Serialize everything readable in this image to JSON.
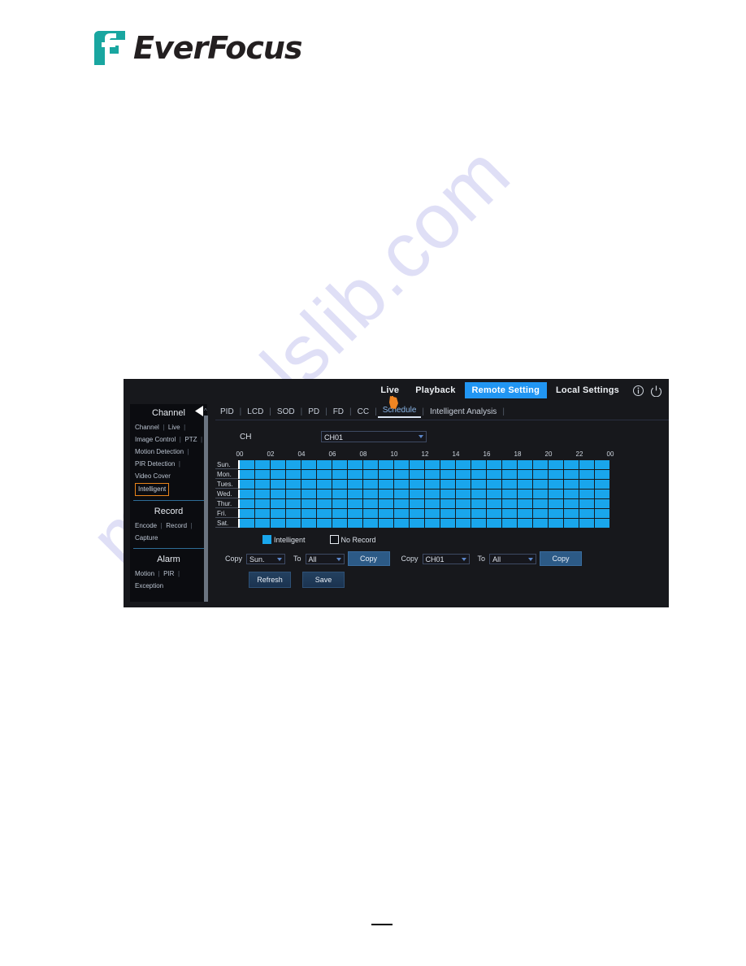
{
  "watermark": {
    "text": "manualslib.com"
  },
  "brand": {
    "name": "EverFocus",
    "mark_color": "#19a6a0",
    "text_color": "#231f20"
  },
  "device_ui": {
    "top_nav": {
      "items": [
        {
          "label": "Live",
          "active": false
        },
        {
          "label": "Playback",
          "active": false
        },
        {
          "label": "Remote Setting",
          "active": true
        },
        {
          "label": "Local Settings",
          "active": false
        }
      ],
      "icons": [
        {
          "name": "info-icon",
          "glyph": "info"
        },
        {
          "name": "power-icon",
          "glyph": "power"
        }
      ],
      "active_color": "#2196f3"
    },
    "sub_tabs": [
      {
        "label": "PID",
        "active": false
      },
      {
        "label": "LCD",
        "active": false
      },
      {
        "label": "SOD",
        "active": false
      },
      {
        "label": "PD",
        "active": false
      },
      {
        "label": "FD",
        "active": false
      },
      {
        "label": "CC",
        "active": false
      },
      {
        "label": "Schedule",
        "active": true
      },
      {
        "label": "Intelligent Analysis",
        "active": false
      }
    ],
    "sidebar": {
      "sections": [
        {
          "title": "Channel",
          "rows": [
            [
              {
                "label": "Channel",
                "highlight": false
              },
              {
                "label": "Live",
                "highlight": false
              }
            ],
            [
              {
                "label": "Image Control",
                "highlight": false
              },
              {
                "label": "PTZ",
                "highlight": false
              }
            ],
            [
              {
                "label": "Motion Detection",
                "highlight": false
              }
            ],
            [
              {
                "label": "PIR Detection",
                "highlight": false
              }
            ],
            [
              {
                "label": "Video Cover",
                "highlight": false,
                "no_sep": true
              }
            ],
            [
              {
                "label": "Intelligent",
                "highlight": true,
                "no_sep": true
              }
            ]
          ]
        },
        {
          "title": "Record",
          "rows": [
            [
              {
                "label": "Encode",
                "highlight": false
              },
              {
                "label": "Record",
                "highlight": false
              }
            ],
            [
              {
                "label": "Capture",
                "highlight": false,
                "no_sep": true
              }
            ]
          ]
        },
        {
          "title": "Alarm",
          "rows": [
            [
              {
                "label": "Motion",
                "highlight": false
              },
              {
                "label": "PIR",
                "highlight": false
              }
            ],
            [
              {
                "label": "Exception",
                "highlight": false,
                "no_sep": true
              }
            ]
          ]
        }
      ],
      "highlight_color": "#e8841a"
    },
    "channel_row": {
      "label": "CH",
      "selected": "CH01"
    },
    "schedule": {
      "time_labels": [
        "00",
        "02",
        "04",
        "06",
        "08",
        "10",
        "12",
        "14",
        "16",
        "18",
        "20",
        "22",
        "00"
      ],
      "days": [
        "Sun.",
        "Mon.",
        "Tues.",
        "Wed.",
        "Thur.",
        "Fri.",
        "Sat."
      ],
      "hours_per_day": 24,
      "cells": [
        [
          1,
          1,
          1,
          1,
          1,
          1,
          1,
          1,
          1,
          1,
          1,
          1,
          1,
          1,
          1,
          1,
          1,
          1,
          1,
          1,
          1,
          1,
          1,
          1
        ],
        [
          1,
          1,
          1,
          1,
          1,
          1,
          1,
          1,
          1,
          1,
          1,
          1,
          1,
          1,
          1,
          1,
          1,
          1,
          1,
          1,
          1,
          1,
          1,
          1
        ],
        [
          1,
          1,
          1,
          1,
          1,
          1,
          1,
          1,
          1,
          1,
          1,
          1,
          1,
          1,
          1,
          1,
          1,
          1,
          1,
          1,
          1,
          1,
          1,
          1
        ],
        [
          1,
          1,
          1,
          1,
          1,
          1,
          1,
          1,
          1,
          1,
          1,
          1,
          1,
          1,
          1,
          1,
          1,
          1,
          1,
          1,
          1,
          1,
          1,
          1
        ],
        [
          1,
          1,
          1,
          1,
          1,
          1,
          1,
          1,
          1,
          1,
          1,
          1,
          1,
          1,
          1,
          1,
          1,
          1,
          1,
          1,
          1,
          1,
          1,
          1
        ],
        [
          1,
          1,
          1,
          1,
          1,
          1,
          1,
          1,
          1,
          1,
          1,
          1,
          1,
          1,
          1,
          1,
          1,
          1,
          1,
          1,
          1,
          1,
          1,
          1
        ],
        [
          1,
          1,
          1,
          1,
          1,
          1,
          1,
          1,
          1,
          1,
          1,
          1,
          1,
          1,
          1,
          1,
          1,
          1,
          1,
          1,
          1,
          1,
          1,
          1
        ]
      ],
      "fill_color": "#19a6ec"
    },
    "legend": [
      {
        "label": "Intelligent",
        "state": "on"
      },
      {
        "label": "No Record",
        "state": "off"
      }
    ],
    "copy_day_row": {
      "copy_label": "Copy",
      "source": "Sun.",
      "to_label": "To",
      "target": "All",
      "button": "Copy"
    },
    "copy_channel_row": {
      "copy_label": "Copy",
      "source": "CH01",
      "to_label": "To",
      "target": "All",
      "button": "Copy"
    },
    "actions": {
      "refresh": "Refresh",
      "save": "Save"
    }
  }
}
